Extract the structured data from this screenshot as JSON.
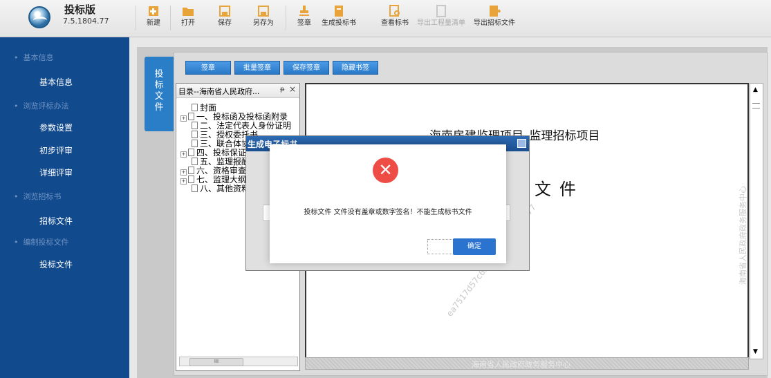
{
  "app": {
    "title": "投标版",
    "version": "7.5.1804.77"
  },
  "toolbar": {
    "new": "新建",
    "open": "打开",
    "save": "保存",
    "save_as": "另存为",
    "sign": "签章",
    "gen_bid": "生成投标书",
    "view_bid": "查看标书",
    "export_list": "导出工程量清单",
    "export_tender": "导出招标文件"
  },
  "sidebar": {
    "group1": "基本信息",
    "item1": "基本信息",
    "group2": "浏览评标办法",
    "item2": "参数设置",
    "item3": "初步评审",
    "item4": "详细评审",
    "group3": "浏览招标书",
    "item5": "招标文件",
    "group4": "编制投标文件",
    "item6": "投标文件"
  },
  "doc_tab": [
    "投",
    "标",
    "文",
    "件"
  ],
  "sign_buttons": {
    "sign": "签章",
    "batch": "批量签章",
    "save": "保存签章",
    "hide": "隐藏书签"
  },
  "outline": {
    "title": "目录--海南省人民政府...",
    "pin": "ᵽ",
    "close": "×",
    "nodes": [
      "封面",
      "一、投标函及投标函附录",
      "二、法定代表人身份证明",
      "三、授权委托书",
      "三、联合体协议书",
      "四、投标保证金",
      "五、监理报酬清单",
      "六、资格审查资料",
      "七、监理大纲",
      "八、其他资料"
    ],
    "scroll_thumb": "III"
  },
  "document": {
    "heading": "海南房建监理项目_监理招标项目",
    "word": "文件",
    "watermark_diag": "ea7517d57c657f14—7.5.1804.77",
    "watermark_side": "海南省人民政府政务服务中心",
    "watermark_bottom": "海南省人民政府政务服务中心"
  },
  "background_dialog": {
    "title": "生成电子标书"
  },
  "alert": {
    "message": "投标文件 文件没有盖章或数字签名！不能生成标书文件",
    "ok": "确定"
  },
  "colors": {
    "sidebar": "#124a8e",
    "accent": "#2a7ec7",
    "error": "#ee4d45"
  }
}
